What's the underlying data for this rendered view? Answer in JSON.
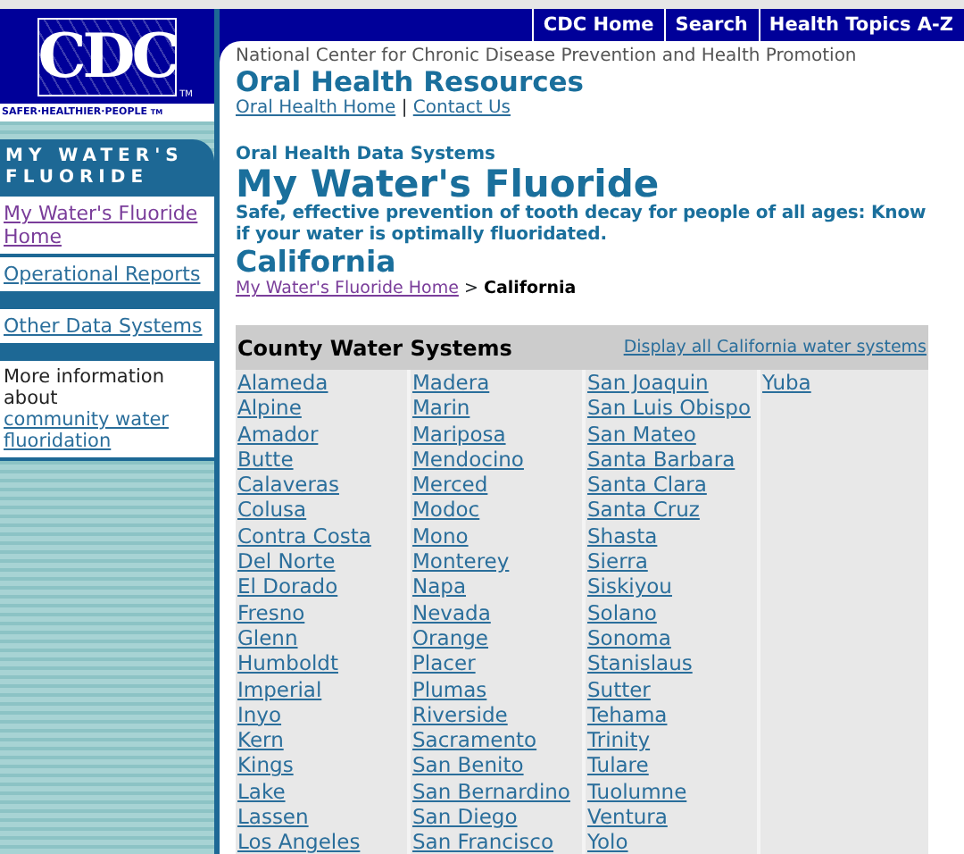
{
  "logo": {
    "text": "CDC",
    "tm": "TM",
    "tagline": "SAFER·HEALTHIER·PEOPLE",
    "tagline_tm": "TM"
  },
  "top_nav": [
    "CDC Home",
    "Search",
    "Health Topics A-Z"
  ],
  "header": {
    "center": "National Center for Chronic Disease Prevention and Health Promotion",
    "title": "Oral Health Resources",
    "links": [
      {
        "label": "Oral Health Home"
      },
      {
        "label": "Contact Us"
      }
    ],
    "separator": "|"
  },
  "sidebar": {
    "title": "MY WATER'S FLUORIDE",
    "items": [
      {
        "kind": "link",
        "label": "My Water's Fluoride Home",
        "visited": true
      },
      {
        "kind": "link",
        "label": "Operational Reports",
        "visited": false
      },
      {
        "kind": "gap"
      },
      {
        "kind": "link",
        "label": "Other Data Systems",
        "visited": false
      },
      {
        "kind": "gap"
      },
      {
        "kind": "text",
        "text": "More information about",
        "link": "community water fluoridation"
      }
    ]
  },
  "main": {
    "kicker": "Oral Health Data Systems",
    "title": "My Water's Fluoride",
    "subtitle": "Safe, effective prevention of tooth decay for people of all ages: Know if your water is optimally fluoridated.",
    "state": "California",
    "breadcrumb": [
      {
        "label": "My Water's Fluoride Home",
        "visited": true
      },
      {
        "label": "California",
        "current": true
      }
    ],
    "breadcrumb_separator": ">",
    "table": {
      "title": "County Water Systems",
      "action": "Display all California water systems",
      "columns": [
        [
          "Alameda",
          "Alpine",
          "Amador",
          "Butte",
          "Calaveras",
          "Colusa",
          "Contra Costa",
          "Del Norte",
          "El Dorado",
          "Fresno",
          "Glenn",
          "Humboldt",
          "Imperial",
          "Inyo",
          "Kern",
          "Kings",
          "Lake",
          "Lassen",
          "Los Angeles"
        ],
        [
          "Madera",
          "Marin",
          "Mariposa",
          "Mendocino",
          "Merced",
          "Modoc",
          "Mono",
          "Monterey",
          "Napa",
          "Nevada",
          "Orange",
          "Placer",
          "Plumas",
          "Riverside",
          "Sacramento",
          "San Benito",
          "San Bernardino",
          "San Diego",
          "San Francisco"
        ],
        [
          "San Joaquin",
          "San Luis Obispo",
          "San Mateo",
          "Santa Barbara",
          "Santa Clara",
          "Santa Cruz",
          "Shasta",
          "Sierra",
          "Siskiyou",
          "Solano",
          "Sonoma",
          "Stanislaus",
          "Sutter",
          "Tehama",
          "Trinity",
          "Tulare",
          "Tuolumne",
          "Ventura",
          "Yolo"
        ],
        [
          "Yuba"
        ]
      ]
    }
  }
}
